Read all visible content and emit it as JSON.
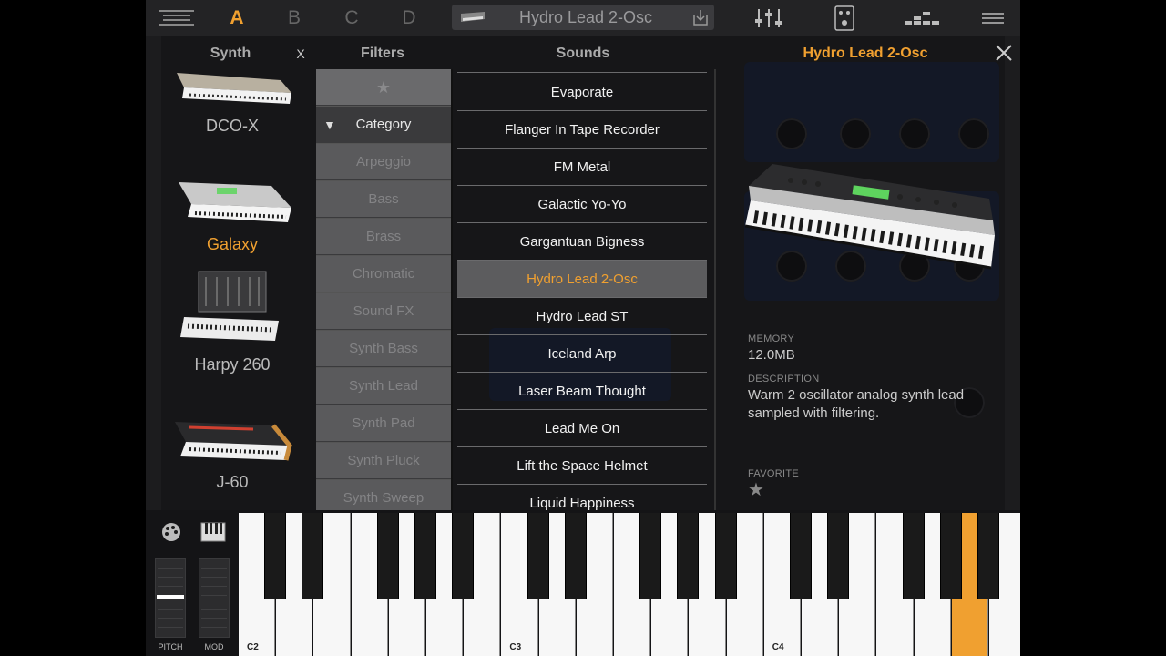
{
  "topbar": {
    "pages": [
      "A",
      "B",
      "C",
      "D"
    ],
    "active_page": "A",
    "preset_name": "Hydro Lead 2-Osc",
    "icons": [
      "menu-lines-icon",
      "keyboard-icon",
      "save-icon",
      "mixer-sliders-icon",
      "effects-pedal-icon",
      "arpeggiator-icon",
      "hamburger-menu-icon"
    ]
  },
  "columns": {
    "synth": "Synth",
    "synth_close": "X",
    "filters": "Filters",
    "sounds": "Sounds"
  },
  "synths": [
    {
      "name": "DCO-X",
      "active": false
    },
    {
      "name": "Galaxy",
      "active": true
    },
    {
      "name": "Harpy 260",
      "active": false
    },
    {
      "name": "J-60",
      "active": false
    }
  ],
  "filters": {
    "favorite_glyph": "★",
    "category_label": "Category",
    "items": [
      "Arpeggio",
      "Bass",
      "Brass",
      "Chromatic",
      "Sound FX",
      "Synth Bass",
      "Synth Lead",
      "Synth Pad",
      "Synth Pluck",
      "Synth Sweep"
    ]
  },
  "sounds": {
    "items": [
      "Evaporate",
      "Flanger In Tape Recorder",
      "FM Metal",
      "Galactic Yo-Yo",
      "Gargantuan Bigness",
      "Hydro Lead 2-Osc",
      "Hydro Lead ST",
      "Iceland Arp",
      "Laser Beam Thought",
      "Lead Me On",
      "Lift the Space Helmet",
      "Liquid Happiness"
    ],
    "selected": "Hydro Lead 2-Osc"
  },
  "info": {
    "title": "Hydro Lead 2-Osc",
    "memory_label": "MEMORY",
    "memory_value": "12.0MB",
    "description_label": "DESCRIPTION",
    "description_value": "Warm 2 oscillator analog synth lead sampled with filtering.",
    "favorite_label": "FAVORITE",
    "favorite_glyph": "★"
  },
  "keyboard": {
    "pitch_label": "PITCH",
    "mod_label": "MOD",
    "octave_labels": [
      "C2",
      "C3",
      "C4"
    ],
    "pressed_note": "A4"
  },
  "colors": {
    "accent": "#f0a030",
    "panel": "#1c1c1e"
  }
}
